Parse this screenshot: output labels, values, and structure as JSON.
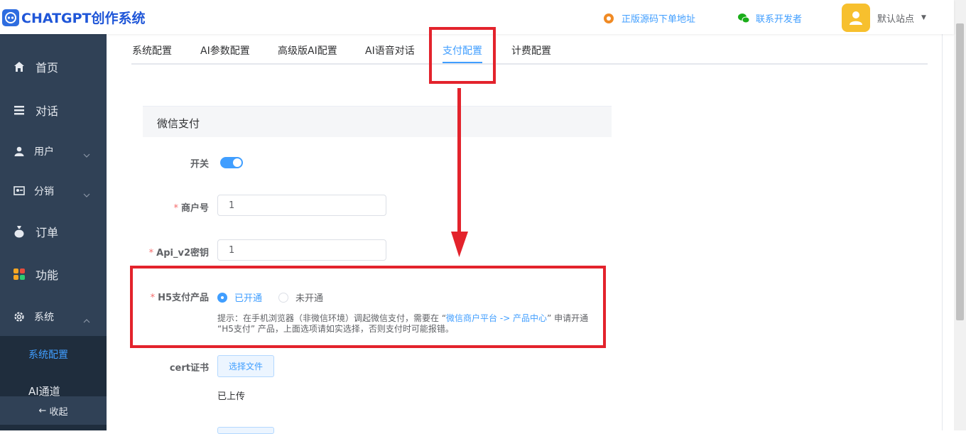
{
  "header": {
    "logo_text": "CHATGPT创作系统",
    "links": [
      {
        "label": "正版源码下单地址",
        "icon": "source-code-icon"
      },
      {
        "label": "联系开发者",
        "icon": "wechat-icon"
      }
    ],
    "user_name": "默认站点"
  },
  "sidebar": {
    "items": [
      {
        "label": "首页",
        "icon": "home-icon"
      },
      {
        "label": "对话",
        "icon": "list-icon"
      },
      {
        "label": "用户",
        "icon": "user-icon",
        "expandable": true
      },
      {
        "label": "分销",
        "icon": "distribution-icon",
        "expandable": true
      },
      {
        "label": "订单",
        "icon": "money-bag-icon"
      },
      {
        "label": "功能",
        "icon": "grid-icon"
      },
      {
        "label": "系统",
        "icon": "gear-icon",
        "expanded": true
      }
    ],
    "sub_items": [
      "系统配置",
      "AI通道"
    ],
    "collapse_label": "收起"
  },
  "tabs": [
    "系统配置",
    "AI参数配置",
    "高级版AI配置",
    "AI语音对话",
    "支付配置",
    "计费配置"
  ],
  "active_tab": "支付配置",
  "section": {
    "title": "微信支付",
    "switch_label": "开关",
    "switch_on": true,
    "mch_id_label": "商户号",
    "mch_id_value": "1",
    "api_key_label": "Api_v2密钥",
    "api_key_value": "1",
    "h5_label": "H5支付产品",
    "h5_options": [
      "已开通",
      "未开通"
    ],
    "h5_selected": "已开通",
    "hint_prefix": "提示：在手机浏览器（非微信环境）调起微信支付，需要在 “",
    "hint_link": "微信商户平台 -> 产品中心",
    "hint_suffix": "” 申请开通 “H5支付” 产品，上面选项请如实选择，否则支付时可能报错。",
    "cert_label": "cert证书",
    "upload_button": "选择文件",
    "upload_status": "已上传"
  },
  "colors": {
    "primary": "#409eff",
    "sidebar_bg": "#304156",
    "annotation_red": "#e3232c"
  }
}
